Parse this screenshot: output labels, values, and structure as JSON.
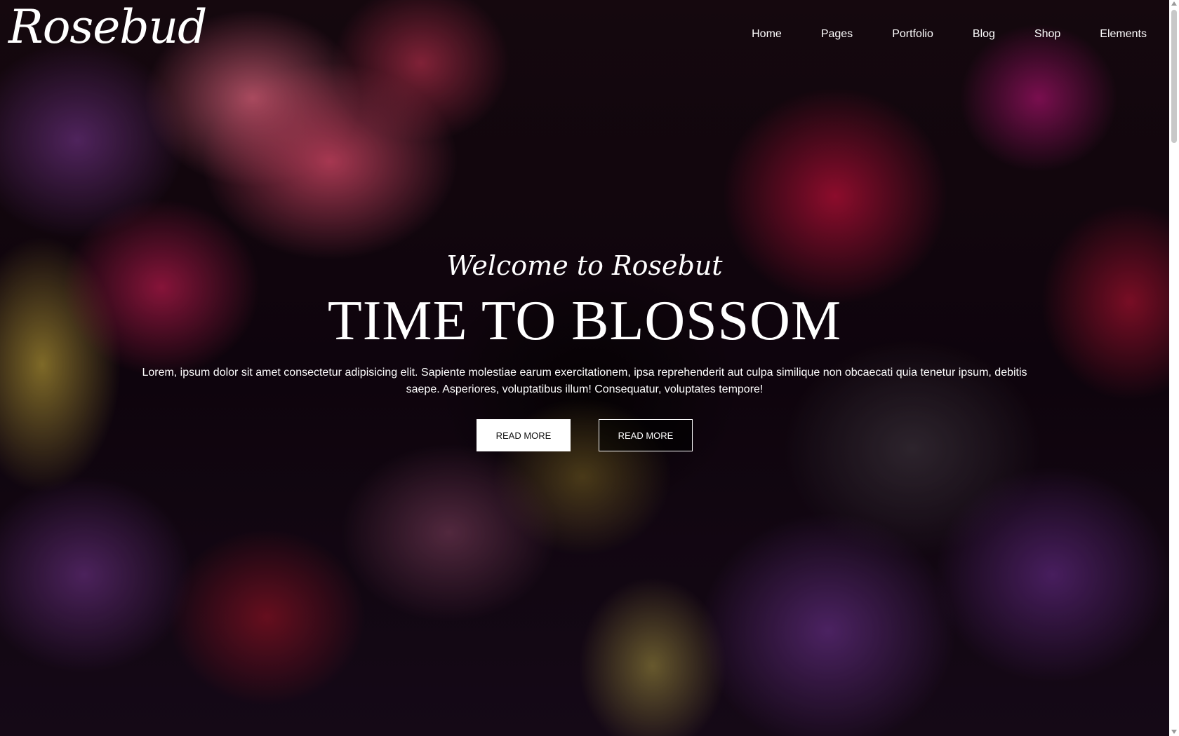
{
  "header": {
    "logo": "Rosebud",
    "nav": [
      {
        "label": "Home"
      },
      {
        "label": "Pages"
      },
      {
        "label": "Portfolio"
      },
      {
        "label": "Blog"
      },
      {
        "label": "Shop"
      },
      {
        "label": "Elements"
      }
    ]
  },
  "hero": {
    "welcome": "Welcome to Rosebut",
    "headline": "TIME TO BLOSSOM",
    "lead": "Lorem, ipsum dolor sit amet consectetur adipisicing elit. Sapiente molestiae earum exercitationem, ipsa reprehenderit aut culpa similique non obcaecati quia tenetur ipsum, debitis saepe. Asperiores, voluptatibus illum! Consequatur, voluptates tempore!",
    "buttons": [
      {
        "label": "READ MORE"
      },
      {
        "label": "READ MORE"
      }
    ],
    "background": "dark floral photo"
  },
  "colors": {
    "text": "#ffffff",
    "button_solid_bg": "#ffffff",
    "button_solid_text": "#111111"
  }
}
